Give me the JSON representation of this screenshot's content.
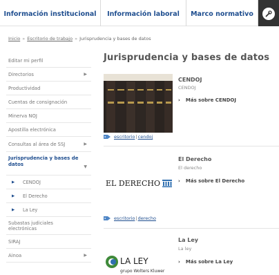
{
  "topnav": {
    "tabs": [
      {
        "label": "Información institucional"
      },
      {
        "label": "Información laboral"
      },
      {
        "label": "Marco normativo"
      }
    ],
    "tool_icon": "wrench-icon"
  },
  "breadcrumb": {
    "items": [
      "Inicio",
      "Escritorio de trabajo",
      "Jurisprudencia y bases de datos"
    ],
    "separator": "»"
  },
  "sidebar": {
    "items": [
      {
        "label": "Editar mi perfil"
      },
      {
        "label": "Directorios"
      },
      {
        "label": "Productividad"
      },
      {
        "label": "Cuentas de consignación"
      },
      {
        "label": "Minerva NOJ"
      },
      {
        "label": "Apostilla electrónica"
      },
      {
        "label": "Consultas al área de SSJ"
      },
      {
        "label": "Jurisprudencia y bases de datos"
      },
      {
        "label": "CENDOJ"
      },
      {
        "label": "El Derecho"
      },
      {
        "label": "La Ley"
      },
      {
        "label": "Subastas judiciales electrónicas"
      },
      {
        "label": "SIRAJ"
      },
      {
        "label": "Ainoa"
      }
    ]
  },
  "main": {
    "title": "Jurisprudencia y bases de datos",
    "entries": [
      {
        "name": "CENDOJ",
        "subtitle": "CENDOJ",
        "more": "Más sobre CENDOJ",
        "tags": [
          "escritorio",
          "cendoj"
        ]
      },
      {
        "name": "El Derecho",
        "subtitle": "El derecho",
        "more": "Más sobre El Derecho",
        "tags": [
          "escritorio",
          "derecho"
        ]
      },
      {
        "name": "La Ley",
        "subtitle": "La ley",
        "more": "Más sobre La Ley"
      }
    ],
    "logos": {
      "derecho": "EL DERECHO",
      "laley": "LA LEY",
      "laley_sub": "grupo Wolters Kluwer"
    }
  },
  "colors": {
    "nav_text": "#1f4e8f",
    "active_tab_bg": "#333333",
    "link": "#1f4e8f",
    "laley_green": "#3f8a3a",
    "derecho_blue": "#2f6fb0"
  }
}
